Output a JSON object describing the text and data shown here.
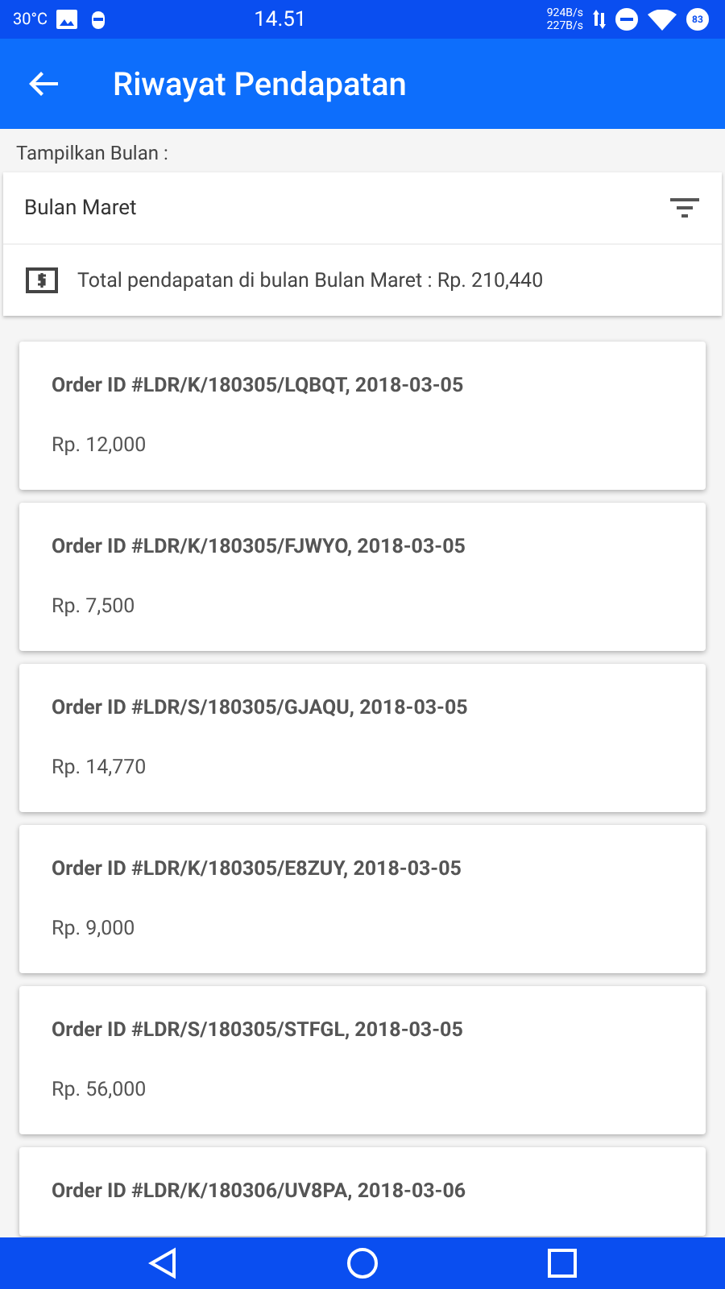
{
  "status_bar": {
    "temperature": "30°C",
    "time": "14.51",
    "speed_down": "924B/s",
    "speed_up": "227B/s",
    "battery": "83"
  },
  "app_bar": {
    "title": "Riwayat Pendapatan"
  },
  "filter": {
    "label": "Tampilkan Bulan :",
    "month": "Bulan Maret",
    "total": "Total pendapatan di bulan Bulan Maret : Rp. 210,440"
  },
  "orders": [
    {
      "title": "Order ID #LDR/K/180305/LQBQT, 2018-03-05",
      "amount": "Rp. 12,000"
    },
    {
      "title": "Order ID #LDR/K/180305/FJWYO, 2018-03-05",
      "amount": "Rp. 7,500"
    },
    {
      "title": "Order ID #LDR/S/180305/GJAQU, 2018-03-05",
      "amount": "Rp. 14,770"
    },
    {
      "title": "Order ID #LDR/K/180305/E8ZUY, 2018-03-05",
      "amount": "Rp. 9,000"
    },
    {
      "title": "Order ID #LDR/S/180305/STFGL, 2018-03-05",
      "amount": "Rp. 56,000"
    },
    {
      "title": "Order ID #LDR/K/180306/UV8PA, 2018-03-06"
    }
  ]
}
